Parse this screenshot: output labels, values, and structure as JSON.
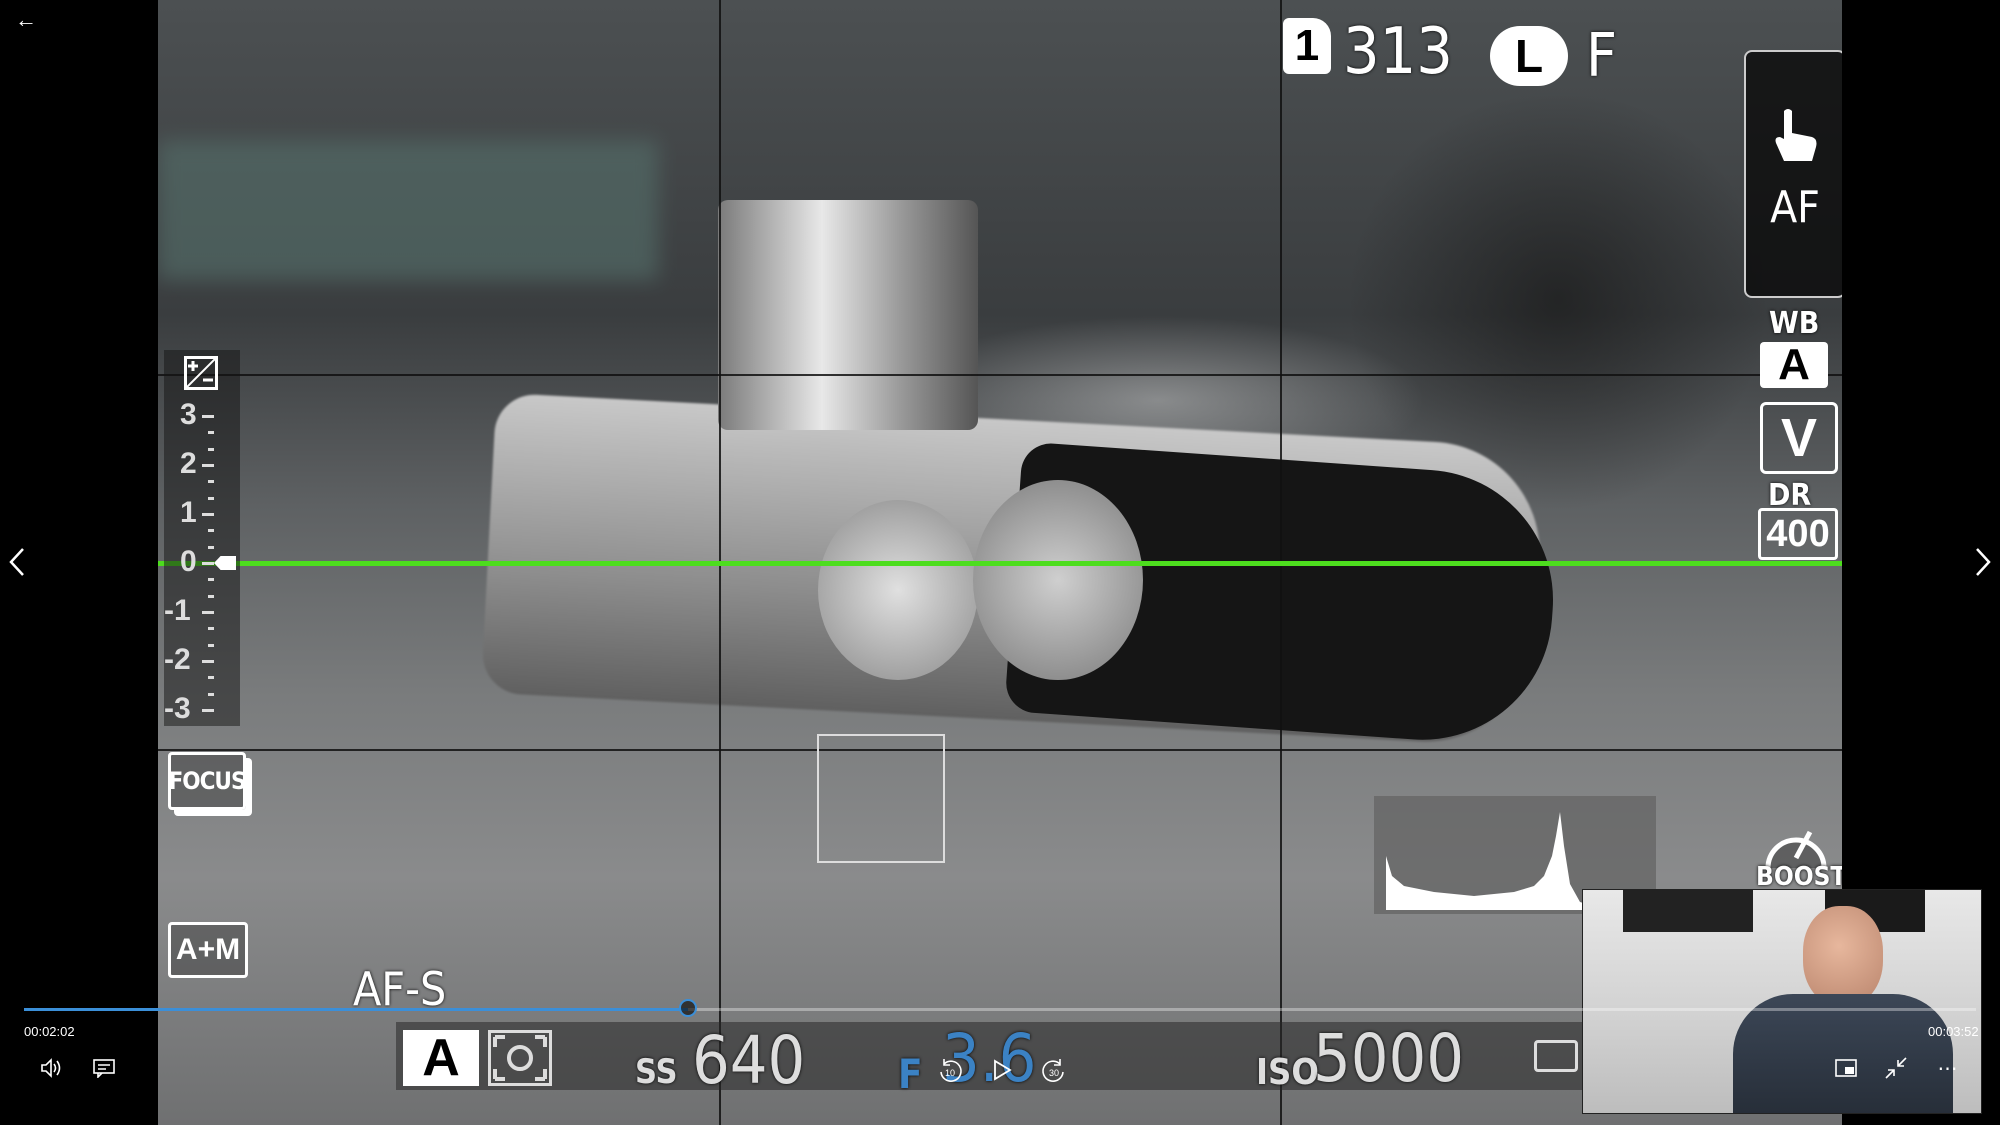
{
  "player": {
    "elapsed": "00:02:02",
    "duration": "00:03:52",
    "progress": 0.34,
    "skip_back_label": "10",
    "skip_forward_label": "30"
  },
  "camera_osd": {
    "frame_counter": "313",
    "image_size": "L",
    "quality": "F",
    "touch_mode": "AF",
    "wb_label": "WB",
    "wb_value": "A",
    "film_sim": "V",
    "dr_label": "DR",
    "dr_value": "400",
    "boost_label": "BOOST",
    "focus_label": "FOCUS",
    "am_label": "A+M",
    "af_mode": "AF-S",
    "shooting_mode": "A",
    "ss_label": "SS",
    "shutter_speed": "640",
    "f_label": "F",
    "aperture": "3.6",
    "iso_label": "ISO",
    "iso": "5000",
    "ev_scale": [
      "3",
      "2",
      "1",
      "0",
      "-1",
      "-2",
      "-3"
    ]
  },
  "colors": {
    "level_line": "#4ddd1e",
    "progress_bar": "#3b8fd8",
    "aperture_highlight": "#3b82c4"
  }
}
